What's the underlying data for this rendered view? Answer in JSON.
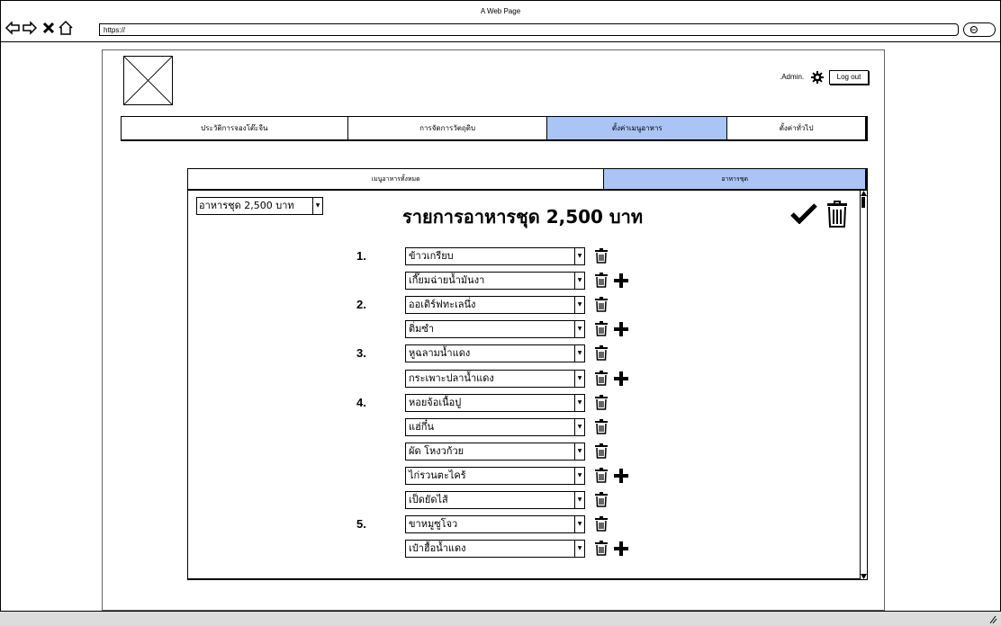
{
  "window": {
    "title": "A Web Page",
    "address": "https://"
  },
  "header": {
    "admin_label": ".Admin.",
    "logout_label": "Log out"
  },
  "main_nav": [
    {
      "label": "ประวัติการจองโต๊ะจีน",
      "active": false
    },
    {
      "label": "การจัดการวัตถุดิบ",
      "active": false
    },
    {
      "label": "ตั้งค่าเมนูอาหาร",
      "active": true
    },
    {
      "label": "ตั้งค่าทั่วไป",
      "active": false
    }
  ],
  "sub_tabs": [
    {
      "label": "เมนูอาหารทั้งหมด",
      "active": false
    },
    {
      "label": "อาหารชุด",
      "active": true
    }
  ],
  "set_selector": {
    "value": "อาหารชุด 2,500 บาท"
  },
  "heading": "รายการอาหารชุด 2,500 บาท",
  "groups": [
    {
      "number": "1.",
      "items": [
        "ข้าวเกรียบ",
        "เกี๊ยมฉ่ายน้ำมันงา"
      ]
    },
    {
      "number": "2.",
      "items": [
        "ออเดิร์ฟทะเลนึ่ง",
        "ติ่มซำ"
      ]
    },
    {
      "number": "3.",
      "items": [
        "หูฉลามน้ำแดง",
        "กระเพาะปลาน้ำแดง"
      ]
    },
    {
      "number": "4.",
      "items": [
        "หอยจ้อเนื้อปู",
        "แฮ่กึ๋น",
        "ผัด โหงวก้วย",
        "ไก่รวนตะไคร้"
      ]
    },
    {
      "number": "5.",
      "items": [
        "เป็ดยัดไส้",
        "ขาหมูซูโจว",
        "เป๋าฮื้อน้ำแดง"
      ]
    }
  ],
  "colors": {
    "active_tab": "#a9c4f5",
    "bottom_bar": "#dcdcdc"
  }
}
